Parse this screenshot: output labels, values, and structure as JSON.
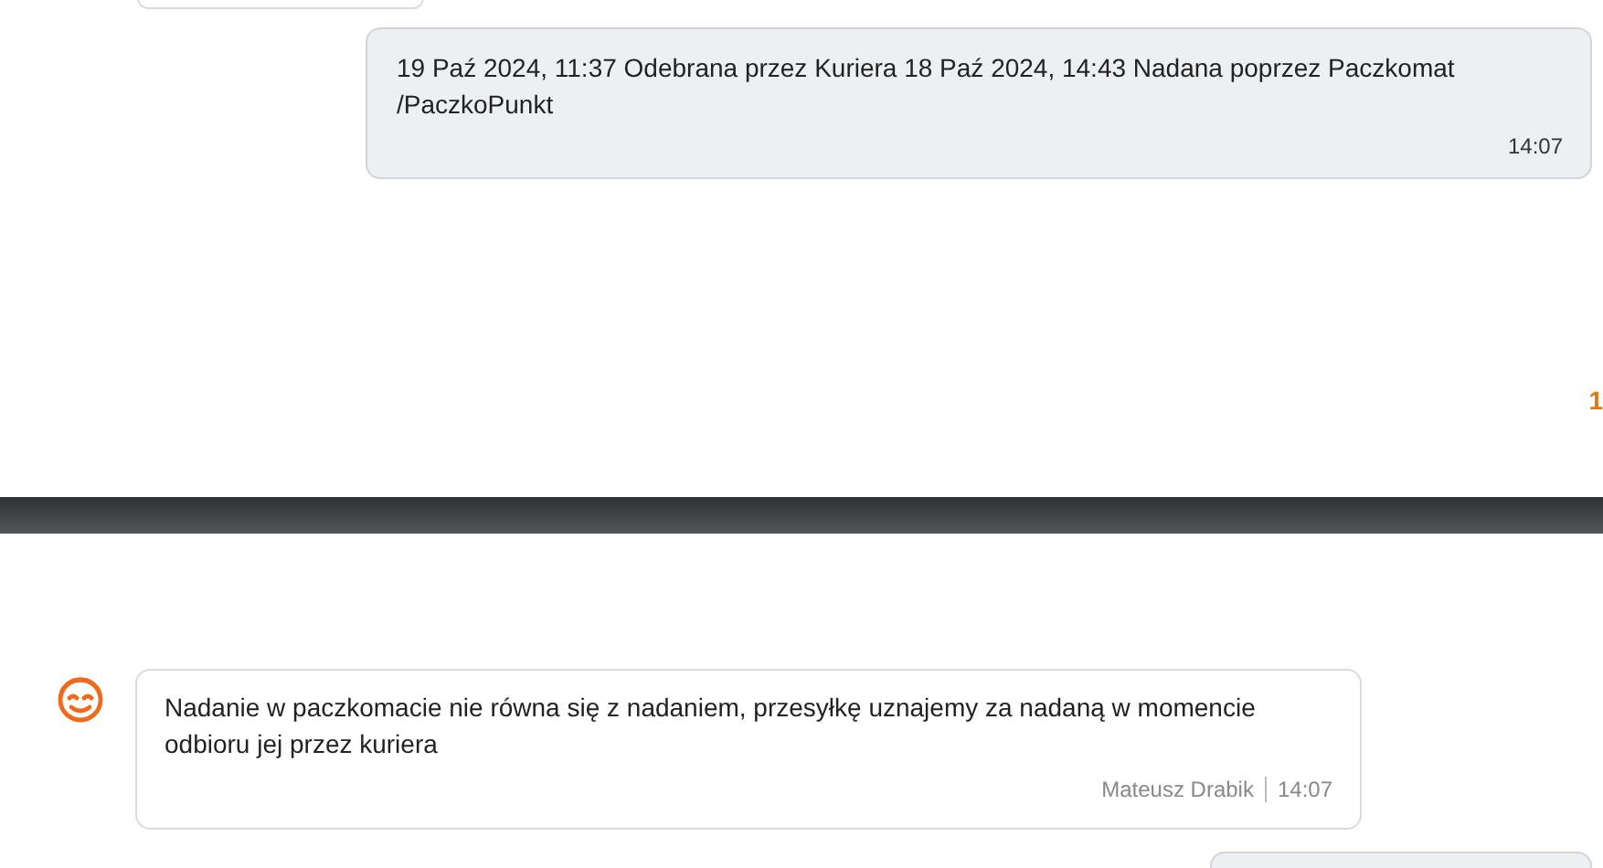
{
  "top_messages": [
    {
      "kind": "cut"
    },
    {
      "kind": "outgoing",
      "text": "19 Paź 2024, 11:37 Odebrana przez Kuriera 18 Paź 2024, 14:43 Nadana poprzez Paczkomat /PaczkoPunkt",
      "time": "14:07"
    }
  ],
  "edge_counter": "1",
  "bottom_messages": [
    {
      "kind": "incoming",
      "text": "Nadanie w paczkomacie nie równa się z nadaniem, przesyłkę uznajemy za nadaną w momencie odbioru jej przez kuriera",
      "author": "Mateusz Drabik",
      "time": "14:07"
    },
    {
      "kind": "cut"
    }
  ]
}
